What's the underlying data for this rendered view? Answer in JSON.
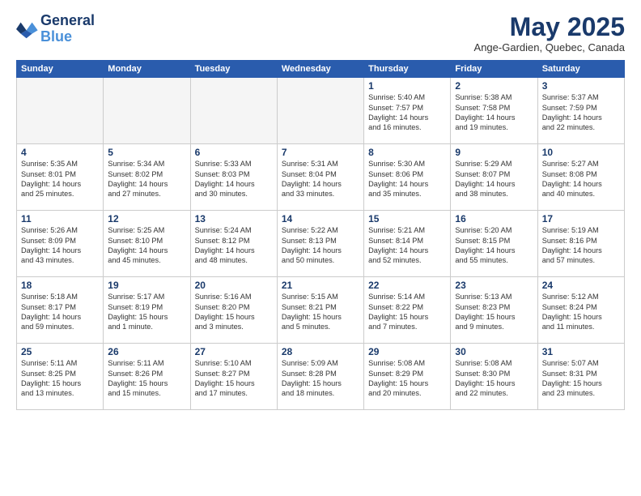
{
  "logo": {
    "line1": "General",
    "line2": "Blue"
  },
  "title": "May 2025",
  "subtitle": "Ange-Gardien, Quebec, Canada",
  "days_of_week": [
    "Sunday",
    "Monday",
    "Tuesday",
    "Wednesday",
    "Thursday",
    "Friday",
    "Saturday"
  ],
  "weeks": [
    [
      {
        "day": "",
        "info": ""
      },
      {
        "day": "",
        "info": ""
      },
      {
        "day": "",
        "info": ""
      },
      {
        "day": "",
        "info": ""
      },
      {
        "day": "1",
        "info": "Sunrise: 5:40 AM\nSunset: 7:57 PM\nDaylight: 14 hours\nand 16 minutes."
      },
      {
        "day": "2",
        "info": "Sunrise: 5:38 AM\nSunset: 7:58 PM\nDaylight: 14 hours\nand 19 minutes."
      },
      {
        "day": "3",
        "info": "Sunrise: 5:37 AM\nSunset: 7:59 PM\nDaylight: 14 hours\nand 22 minutes."
      }
    ],
    [
      {
        "day": "4",
        "info": "Sunrise: 5:35 AM\nSunset: 8:01 PM\nDaylight: 14 hours\nand 25 minutes."
      },
      {
        "day": "5",
        "info": "Sunrise: 5:34 AM\nSunset: 8:02 PM\nDaylight: 14 hours\nand 27 minutes."
      },
      {
        "day": "6",
        "info": "Sunrise: 5:33 AM\nSunset: 8:03 PM\nDaylight: 14 hours\nand 30 minutes."
      },
      {
        "day": "7",
        "info": "Sunrise: 5:31 AM\nSunset: 8:04 PM\nDaylight: 14 hours\nand 33 minutes."
      },
      {
        "day": "8",
        "info": "Sunrise: 5:30 AM\nSunset: 8:06 PM\nDaylight: 14 hours\nand 35 minutes."
      },
      {
        "day": "9",
        "info": "Sunrise: 5:29 AM\nSunset: 8:07 PM\nDaylight: 14 hours\nand 38 minutes."
      },
      {
        "day": "10",
        "info": "Sunrise: 5:27 AM\nSunset: 8:08 PM\nDaylight: 14 hours\nand 40 minutes."
      }
    ],
    [
      {
        "day": "11",
        "info": "Sunrise: 5:26 AM\nSunset: 8:09 PM\nDaylight: 14 hours\nand 43 minutes."
      },
      {
        "day": "12",
        "info": "Sunrise: 5:25 AM\nSunset: 8:10 PM\nDaylight: 14 hours\nand 45 minutes."
      },
      {
        "day": "13",
        "info": "Sunrise: 5:24 AM\nSunset: 8:12 PM\nDaylight: 14 hours\nand 48 minutes."
      },
      {
        "day": "14",
        "info": "Sunrise: 5:22 AM\nSunset: 8:13 PM\nDaylight: 14 hours\nand 50 minutes."
      },
      {
        "day": "15",
        "info": "Sunrise: 5:21 AM\nSunset: 8:14 PM\nDaylight: 14 hours\nand 52 minutes."
      },
      {
        "day": "16",
        "info": "Sunrise: 5:20 AM\nSunset: 8:15 PM\nDaylight: 14 hours\nand 55 minutes."
      },
      {
        "day": "17",
        "info": "Sunrise: 5:19 AM\nSunset: 8:16 PM\nDaylight: 14 hours\nand 57 minutes."
      }
    ],
    [
      {
        "day": "18",
        "info": "Sunrise: 5:18 AM\nSunset: 8:17 PM\nDaylight: 14 hours\nand 59 minutes."
      },
      {
        "day": "19",
        "info": "Sunrise: 5:17 AM\nSunset: 8:19 PM\nDaylight: 15 hours\nand 1 minute."
      },
      {
        "day": "20",
        "info": "Sunrise: 5:16 AM\nSunset: 8:20 PM\nDaylight: 15 hours\nand 3 minutes."
      },
      {
        "day": "21",
        "info": "Sunrise: 5:15 AM\nSunset: 8:21 PM\nDaylight: 15 hours\nand 5 minutes."
      },
      {
        "day": "22",
        "info": "Sunrise: 5:14 AM\nSunset: 8:22 PM\nDaylight: 15 hours\nand 7 minutes."
      },
      {
        "day": "23",
        "info": "Sunrise: 5:13 AM\nSunset: 8:23 PM\nDaylight: 15 hours\nand 9 minutes."
      },
      {
        "day": "24",
        "info": "Sunrise: 5:12 AM\nSunset: 8:24 PM\nDaylight: 15 hours\nand 11 minutes."
      }
    ],
    [
      {
        "day": "25",
        "info": "Sunrise: 5:11 AM\nSunset: 8:25 PM\nDaylight: 15 hours\nand 13 minutes."
      },
      {
        "day": "26",
        "info": "Sunrise: 5:11 AM\nSunset: 8:26 PM\nDaylight: 15 hours\nand 15 minutes."
      },
      {
        "day": "27",
        "info": "Sunrise: 5:10 AM\nSunset: 8:27 PM\nDaylight: 15 hours\nand 17 minutes."
      },
      {
        "day": "28",
        "info": "Sunrise: 5:09 AM\nSunset: 8:28 PM\nDaylight: 15 hours\nand 18 minutes."
      },
      {
        "day": "29",
        "info": "Sunrise: 5:08 AM\nSunset: 8:29 PM\nDaylight: 15 hours\nand 20 minutes."
      },
      {
        "day": "30",
        "info": "Sunrise: 5:08 AM\nSunset: 8:30 PM\nDaylight: 15 hours\nand 22 minutes."
      },
      {
        "day": "31",
        "info": "Sunrise: 5:07 AM\nSunset: 8:31 PM\nDaylight: 15 hours\nand 23 minutes."
      }
    ]
  ]
}
